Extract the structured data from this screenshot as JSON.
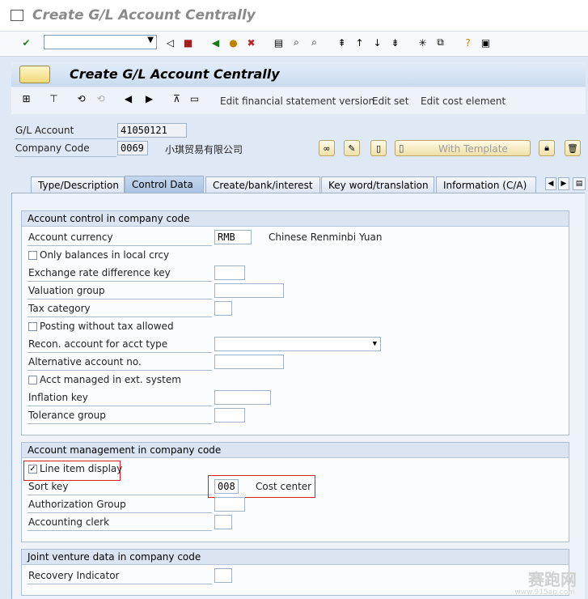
{
  "window": {
    "title": "Create G/L Account Centrally"
  },
  "screen": {
    "title": "Create G/L Account Centrally"
  },
  "app_toolbar": {
    "links": [
      "Edit financial statement version",
      "Edit set",
      "Edit cost element"
    ]
  },
  "header": {
    "gl_account_label": "G/L Account",
    "gl_account_value": "41050121",
    "company_code_label": "Company Code",
    "company_code_value": "0069",
    "company_name": "小琪贸易有限公司",
    "with_template_label": "With Template"
  },
  "tabs": [
    {
      "label": "Type/Description",
      "active": false
    },
    {
      "label": "Control Data",
      "active": true
    },
    {
      "label": "Create/bank/interest",
      "active": false
    },
    {
      "label": "Key word/translation",
      "active": false
    },
    {
      "label": "Information (C/A)",
      "active": false
    }
  ],
  "account_control": {
    "title": "Account control in company code",
    "account_currency_label": "Account currency",
    "account_currency_value": "RMB",
    "account_currency_text": "Chinese Renminbi Yuan",
    "only_balances_label": "Only balances in local crcy",
    "exchange_rate_label": "Exchange rate difference key",
    "valuation_group_label": "Valuation group",
    "tax_category_label": "Tax category",
    "posting_without_tax_label": "Posting without tax allowed",
    "recon_account_label": "Recon. account for acct type",
    "alt_account_label": "Alternative account no.",
    "acct_managed_label": "Acct managed in ext. system",
    "inflation_key_label": "Inflation key",
    "tolerance_group_label": "Tolerance group"
  },
  "account_mgmt": {
    "title": "Account management in company code",
    "line_item_label": "Line item display",
    "line_item_checked": true,
    "sort_key_label": "Sort key",
    "sort_key_value": "008",
    "sort_key_text": "Cost center",
    "auth_group_label": "Authorization Group",
    "accounting_clerk_label": "Accounting clerk"
  },
  "joint_venture": {
    "title": "Joint venture data in company code",
    "recovery_label": "Recovery Indicator"
  },
  "watermark": {
    "text": "赛跑网",
    "url": "www.915ap.com"
  },
  "colors": {
    "accent": "#a9c3e3",
    "highlight": "#d62020",
    "header_bg": "#dfe9f5"
  }
}
